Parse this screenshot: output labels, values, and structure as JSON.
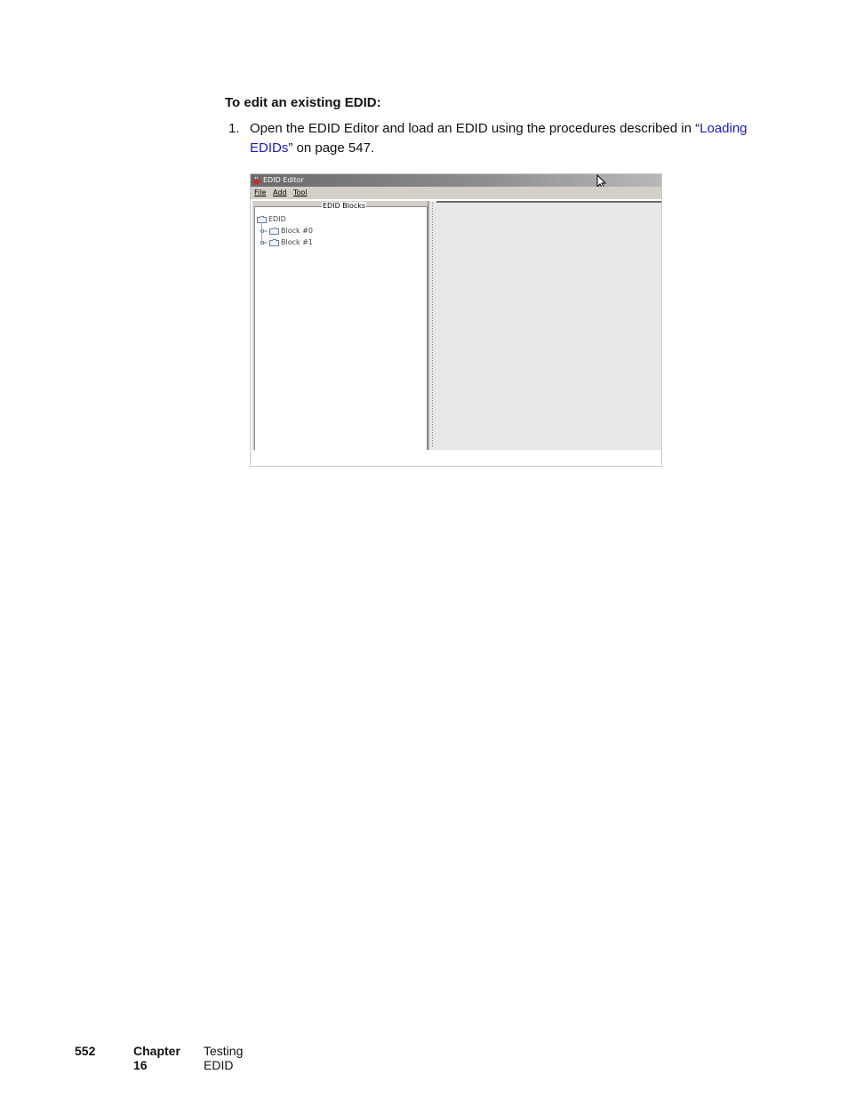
{
  "heading": "To edit an existing EDID:",
  "step": {
    "number": "1.",
    "text_before": "Open the EDID Editor and load an EDID using the procedures described in “",
    "link_text": "Loading EDIDs",
    "text_after": "” on page 547."
  },
  "app": {
    "window_title": "EDID Editor",
    "icons": {
      "app": "java-cup-icon",
      "cursor": "mouse-pointer-icon",
      "folder": "folder-icon",
      "expand": "tree-expand-handle-icon"
    },
    "menu": [
      "File",
      "Add",
      "Tool"
    ],
    "panel_title": "EDID Blocks",
    "tree": {
      "root": "EDID",
      "children": [
        "Block #0",
        "Block #1"
      ]
    }
  },
  "footer": {
    "page_number": "552",
    "chapter": "Chapter 16",
    "chapter_title": "Testing EDID"
  },
  "colors": {
    "link": "#1a1ac8"
  }
}
